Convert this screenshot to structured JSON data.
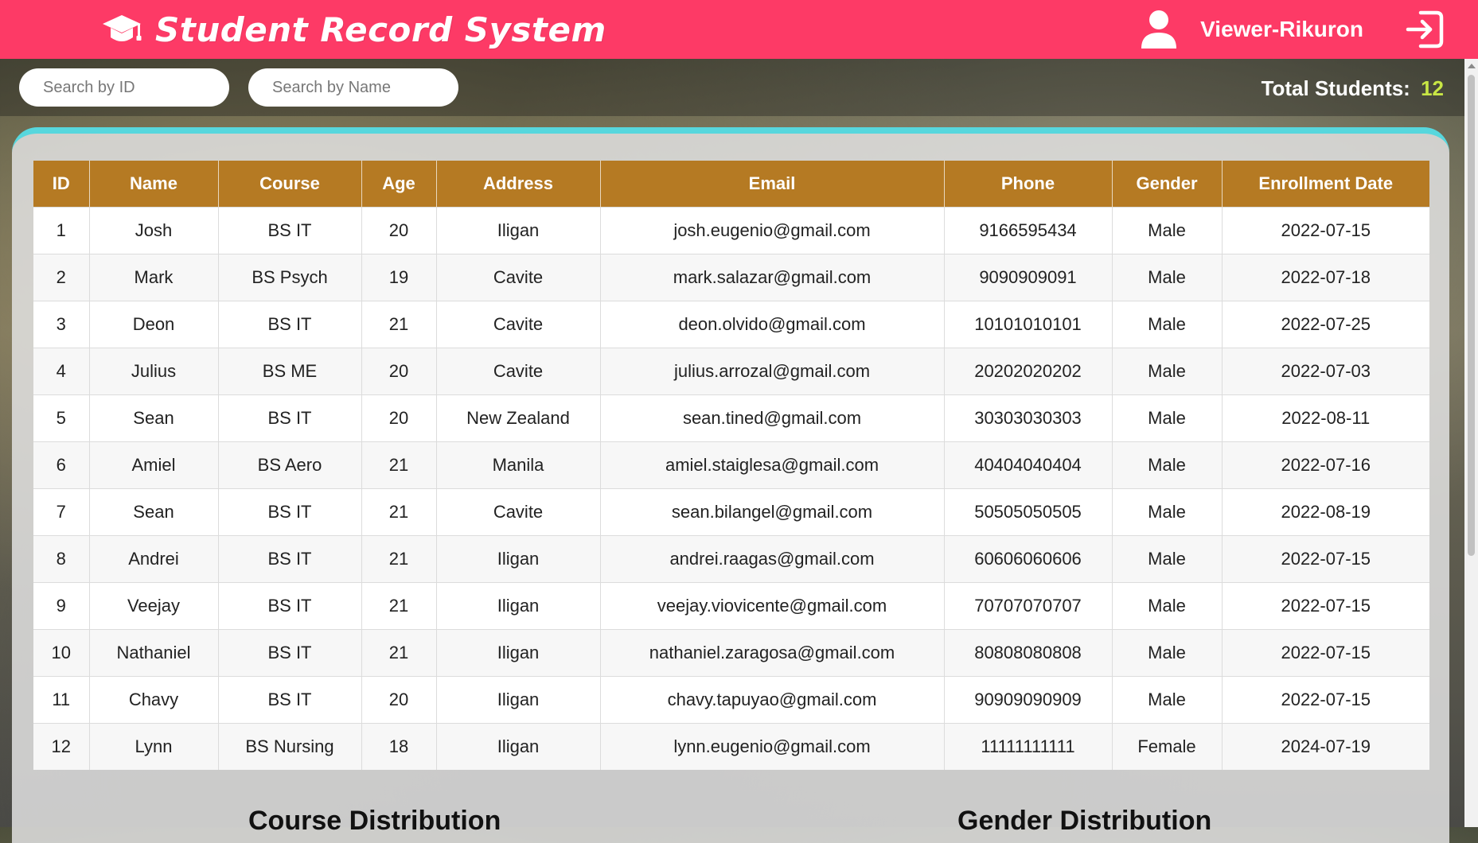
{
  "header": {
    "title": "Student Record System",
    "brand_icon": "graduation-cap-icon",
    "user_icon": "user-icon",
    "user_name": "Viewer-Rikuron",
    "logout_icon": "logout-icon",
    "color": "#fd3a66"
  },
  "toolbar": {
    "search_id_placeholder": "Search by ID",
    "search_id_value": "",
    "search_name_placeholder": "Search by Name",
    "search_name_value": "",
    "total_label": "Total Students:",
    "total_count": "12",
    "total_count_color": "#c8e645"
  },
  "table": {
    "header_color": "#b57a23",
    "columns": [
      "ID",
      "Name",
      "Course",
      "Age",
      "Address",
      "Email",
      "Phone",
      "Gender",
      "Enrollment Date"
    ],
    "rows": [
      [
        "1",
        "Josh",
        "BS IT",
        "20",
        "Iligan",
        "josh.eugenio@gmail.com",
        "9166595434",
        "Male",
        "2022-07-15"
      ],
      [
        "2",
        "Mark",
        "BS Psych",
        "19",
        "Cavite",
        "mark.salazar@gmail.com",
        "9090909091",
        "Male",
        "2022-07-18"
      ],
      [
        "3",
        "Deon",
        "BS IT",
        "21",
        "Cavite",
        "deon.olvido@gmail.com",
        "10101010101",
        "Male",
        "2022-07-25"
      ],
      [
        "4",
        "Julius",
        "BS ME",
        "20",
        "Cavite",
        "julius.arrozal@gmail.com",
        "20202020202",
        "Male",
        "2022-07-03"
      ],
      [
        "5",
        "Sean",
        "BS IT",
        "20",
        "New Zealand",
        "sean.tined@gmail.com",
        "30303030303",
        "Male",
        "2022-08-11"
      ],
      [
        "6",
        "Amiel",
        "BS Aero",
        "21",
        "Manila",
        "amiel.staiglesa@gmail.com",
        "40404040404",
        "Male",
        "2022-07-16"
      ],
      [
        "7",
        "Sean",
        "BS IT",
        "21",
        "Cavite",
        "sean.bilangel@gmail.com",
        "50505050505",
        "Male",
        "2022-08-19"
      ],
      [
        "8",
        "Andrei",
        "BS IT",
        "21",
        "Iligan",
        "andrei.raagas@gmail.com",
        "60606060606",
        "Male",
        "2022-07-15"
      ],
      [
        "9",
        "Veejay",
        "BS IT",
        "21",
        "Iligan",
        "veejay.viovicente@gmail.com",
        "70707070707",
        "Male",
        "2022-07-15"
      ],
      [
        "10",
        "Nathaniel",
        "BS IT",
        "21",
        "Iligan",
        "nathaniel.zaragosa@gmail.com",
        "80808080808",
        "Male",
        "2022-07-15"
      ],
      [
        "11",
        "Chavy",
        "BS IT",
        "20",
        "Iligan",
        "chavy.tapuyao@gmail.com",
        "90909090909",
        "Male",
        "2022-07-15"
      ],
      [
        "12",
        "Lynn",
        "BS Nursing",
        "18",
        "Iligan",
        "lynn.eugenio@gmail.com",
        "11111111111",
        "Female",
        "2024-07-19"
      ]
    ]
  },
  "sections": {
    "course_title": "Course Distribution",
    "gender_title": "Gender Distribution"
  }
}
